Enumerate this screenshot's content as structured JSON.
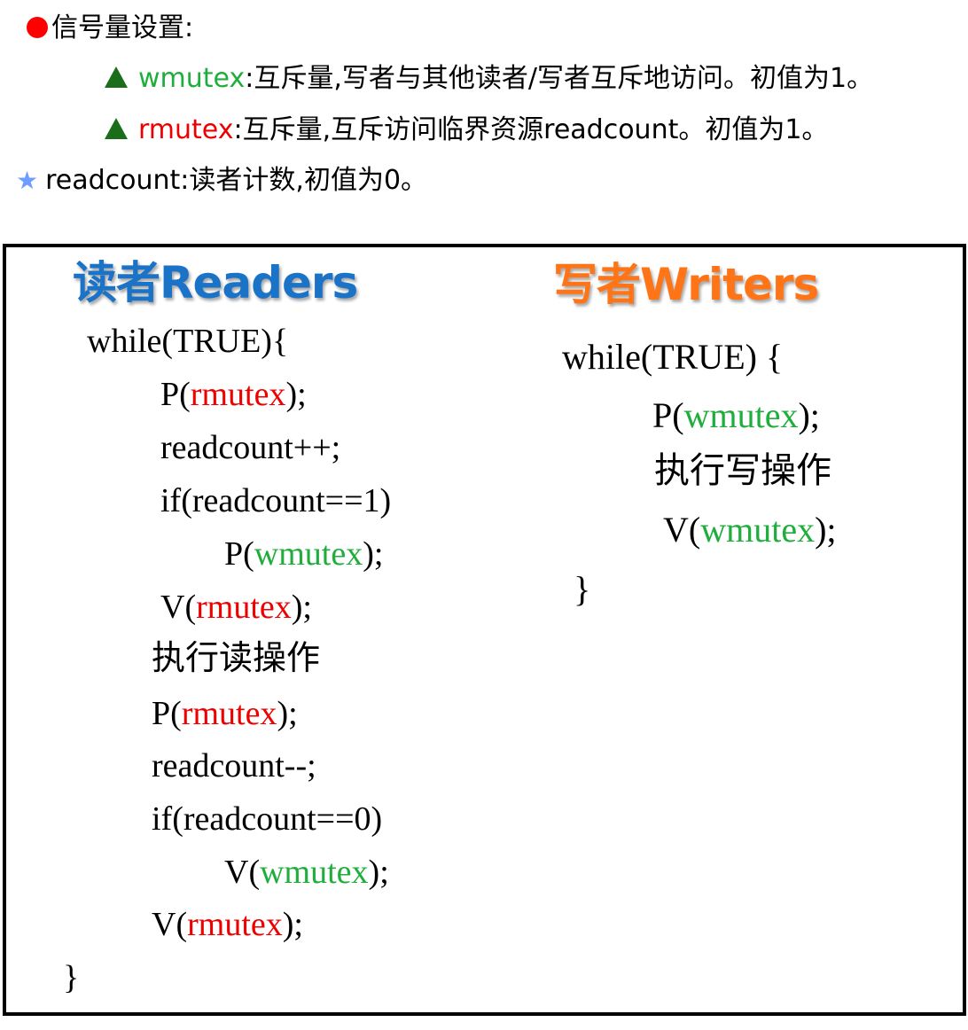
{
  "intro": {
    "title": "信号量设置:",
    "wmutex_name": "wmutex",
    "wmutex_desc": ":互斥量,写者与其他读者/写者互斥地访问。初值为1。",
    "rmutex_name": "rmutex",
    "rmutex_desc": ":互斥量,互斥访问临界资源readcount。初值为1。",
    "readcount_line": "readcount:读者计数,初值为0。"
  },
  "readers": {
    "heading": "读者Readers",
    "while": "while(TRUE){",
    "p1_pre": "P(",
    "p1_sem": "rmutex",
    "p1_post": ");",
    "inc": "readcount++;",
    "if1": "if(readcount==1)",
    "p2_pre": "P(",
    "p2_sem": "wmutex",
    "p2_post": ");",
    "v1_pre": "V(",
    "v1_sem": "rmutex",
    "v1_post": ");",
    "do_read": "执行读操作",
    "p3_pre": "P(",
    "p3_sem": "rmutex",
    "p3_post": ");",
    "dec": "readcount--;",
    "if2": "if(readcount==0)",
    "v2_pre": "V(",
    "v2_sem": "wmutex",
    "v2_post": ");",
    "v3_pre": "V(",
    "v3_sem": "rmutex",
    "v3_post": ");",
    "close": "}"
  },
  "writers": {
    "heading": "写者Writers",
    "while": "while(TRUE) {",
    "p_pre": "P(",
    "p_sem": "wmutex",
    "p_post": ");",
    "do_write": "执行写操作",
    "v_pre": "V(",
    "v_sem": "wmutex",
    "v_post": ");",
    "close": "}"
  },
  "colors": {
    "green": "#1fae3c",
    "red": "#ee0000",
    "readers_heading": "#1a73c7",
    "writers_heading": "#ff7417"
  }
}
